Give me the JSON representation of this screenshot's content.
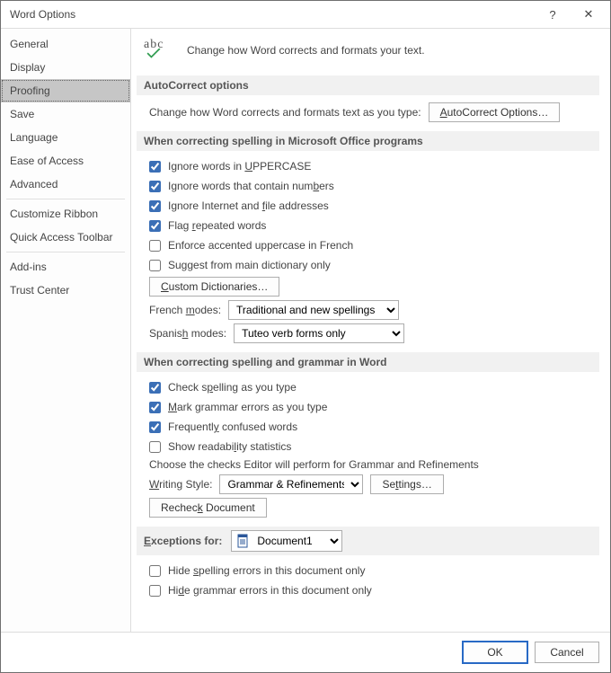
{
  "window": {
    "title": "Word Options"
  },
  "titlebar": {
    "help": "?",
    "close": "✕"
  },
  "sidebar": {
    "items": [
      {
        "label": "General",
        "selected": false
      },
      {
        "label": "Display",
        "selected": false
      },
      {
        "label": "Proofing",
        "selected": true
      },
      {
        "label": "Save",
        "selected": false
      },
      {
        "label": "Language",
        "selected": false
      },
      {
        "label": "Ease of Access",
        "selected": false
      },
      {
        "label": "Advanced",
        "selected": false
      },
      {
        "label": "Customize Ribbon",
        "selected": false
      },
      {
        "label": "Quick Access Toolbar",
        "selected": false
      },
      {
        "label": "Add-ins",
        "selected": false
      },
      {
        "label": "Trust Center",
        "selected": false
      }
    ]
  },
  "intro": {
    "text": "Change how Word corrects and formats your text."
  },
  "sec_autocorrect": {
    "header": "AutoCorrect options",
    "line": "Change how Word corrects and formats text as you type:",
    "button": "AutoCorrect Options…"
  },
  "sec_office": {
    "header": "When correcting spelling in Microsoft Office programs",
    "cb": {
      "uppercase": "Ignore words in UPPERCASE",
      "numbers": "Ignore words that contain numbers",
      "internet": "Ignore Internet and file addresses",
      "repeated": "Flag repeated words",
      "french_accent": "Enforce accented uppercase in French",
      "main_dict": "Suggest from main dictionary only"
    },
    "btn_custom_dict": "Custom Dictionaries…",
    "french_label": "French modes:",
    "french_value": "Traditional and new spellings",
    "spanish_label": "Spanish modes:",
    "spanish_value": "Tuteo verb forms only"
  },
  "sec_word": {
    "header": "When correcting spelling and grammar in Word",
    "cb": {
      "check_spelling": "Check spelling as you type",
      "mark_grammar": "Mark grammar errors as you type",
      "confused": "Frequently confused words",
      "readability": "Show readability statistics"
    },
    "choose_line": "Choose the checks Editor will perform for Grammar and Refinements",
    "writing_style_label": "Writing Style:",
    "writing_style_value": "Grammar & Refinements",
    "btn_settings": "Settings…",
    "btn_recheck": "Recheck Document"
  },
  "sec_exceptions": {
    "header": "Exceptions for:",
    "doc_value": "Document1",
    "cb": {
      "hide_spelling": "Hide spelling errors in this document only",
      "hide_grammar": "Hide grammar errors in this document only"
    }
  },
  "footer": {
    "ok": "OK",
    "cancel": "Cancel"
  }
}
